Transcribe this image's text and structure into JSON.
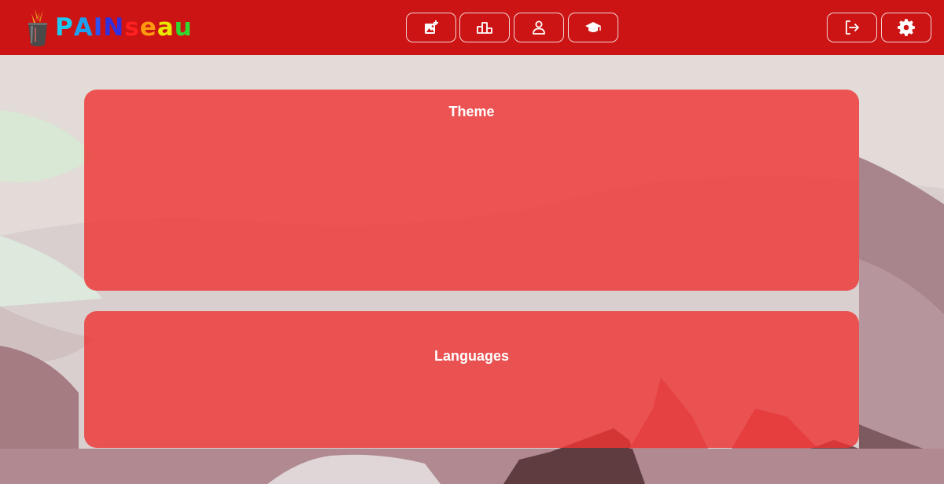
{
  "app": {
    "logo_text": [
      "P",
      "A",
      "I",
      "N",
      "s",
      "e",
      "a",
      "u"
    ],
    "logo_colors": [
      "#1ec8f0",
      "#1ea0f0",
      "#3050f0",
      "#3030e0",
      "#ff2020",
      "#ff9a10",
      "#e8e800",
      "#30d830"
    ],
    "logo_icon": "paintbrush-cup-icon"
  },
  "header": {
    "background": "#cc1414",
    "nav_buttons": [
      {
        "icon": "add-image-icon"
      },
      {
        "icon": "podium-icon"
      },
      {
        "icon": "user-icon"
      },
      {
        "icon": "graduation-cap-icon"
      }
    ],
    "right_buttons": [
      {
        "icon": "logout-icon"
      },
      {
        "icon": "gear-icon"
      }
    ]
  },
  "settings": {
    "theme_title": "Theme",
    "languages_title": "Languages"
  },
  "colors": {
    "panel": "#ee3434",
    "text": "#ffffff"
  }
}
